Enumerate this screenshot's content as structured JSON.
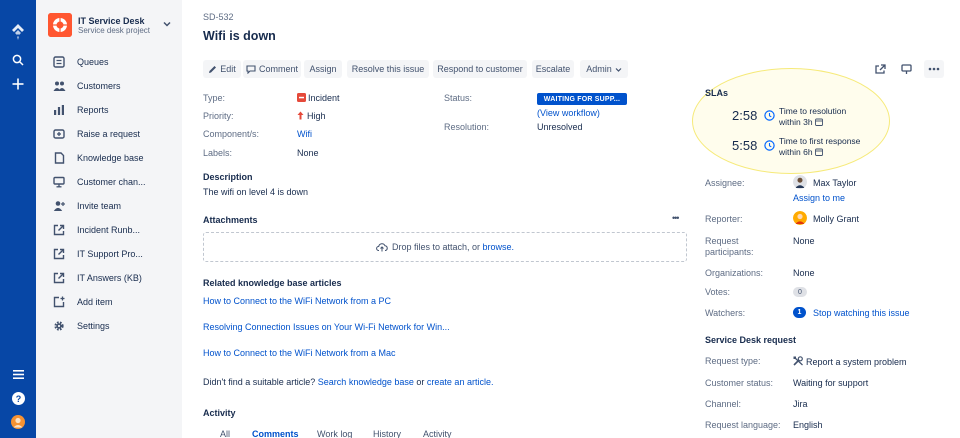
{
  "sidebar": {
    "project_name": "IT Service Desk",
    "project_type": "Service desk project",
    "items": [
      {
        "label": "Queues"
      },
      {
        "label": "Customers"
      },
      {
        "label": "Reports"
      },
      {
        "label": "Raise a request"
      },
      {
        "label": "Knowledge base"
      },
      {
        "label": "Customer chan..."
      },
      {
        "label": "Invite team"
      },
      {
        "label": "Incident Runb..."
      },
      {
        "label": "IT Support Pro..."
      },
      {
        "label": "IT Answers (KB)"
      },
      {
        "label": "Add item"
      },
      {
        "label": "Settings"
      }
    ]
  },
  "issue": {
    "key": "SD-532",
    "title": "Wifi is down"
  },
  "toolbar": {
    "edit": "Edit",
    "comment": "Comment",
    "assign": "Assign",
    "resolve": "Resolve this issue",
    "respond": "Respond to customer",
    "escalate": "Escalate",
    "admin": "Admin"
  },
  "details": {
    "type_label": "Type:",
    "type_value": "Incident",
    "priority_label": "Priority:",
    "priority_value": "High",
    "components_label": "Component/s:",
    "components_value": "Wifi",
    "labels_label": "Labels:",
    "labels_value": "None",
    "status_label": "Status:",
    "status_value": "WAITING FOR SUPP...",
    "view_workflow": "(View workflow)",
    "resolution_label": "Resolution:",
    "resolution_value": "Unresolved"
  },
  "description": {
    "heading": "Description",
    "text": "The wifi on level 4 is down"
  },
  "attachments": {
    "heading": "Attachments",
    "more": "•••",
    "drop_text": "Drop files to attach, or",
    "browse": "browse."
  },
  "kb": {
    "heading": "Related knowledge base articles",
    "articles": [
      "How to Connect to the WiFi Network from a PC",
      "Resolving Connection Issues on Your Wi-Fi Network for Win...",
      "How to Connect to the WiFi Network from a Mac"
    ],
    "not_found_prefix": "Didn't find a suitable article?",
    "search_link": "Search knowledge base",
    "or": "or",
    "create_link": "create an article."
  },
  "activity": {
    "heading": "Activity",
    "tabs": [
      "All",
      "Comments",
      "Work log",
      "History",
      "Activity"
    ],
    "active_tab": "Comments"
  },
  "sla": {
    "heading": "SLAs",
    "items": [
      {
        "time": "2:58",
        "line1": "Time to resolution",
        "line2": "within 3h"
      },
      {
        "time": "5:58",
        "line1": "Time to first response",
        "line2": "within 6h"
      }
    ]
  },
  "people": {
    "assignee_label": "Assignee:",
    "assignee": "Max Taylor",
    "assign_to_me": "Assign to me",
    "reporter_label": "Reporter:",
    "reporter": "Molly Grant",
    "participants_label_1": "Request",
    "participants_label_2": "participants:",
    "participants": "None",
    "organizations_label": "Organizations:",
    "organizations": "None",
    "votes_label": "Votes:",
    "votes": "0",
    "watchers_label": "Watchers:",
    "watchers": "1",
    "stop_watching": "Stop watching this issue"
  },
  "service_desk": {
    "heading": "Service Desk request",
    "request_type_label": "Request type:",
    "request_type": "Report a system problem",
    "customer_status_label": "Customer status:",
    "customer_status": "Waiting for support",
    "channel_label": "Channel:",
    "channel": "Jira",
    "language_label": "Request language:",
    "language": "English"
  },
  "colors": {
    "nav": "#0747a6",
    "link": "#0052cc",
    "incident": "#e5493a",
    "priority_high": "#e5493a",
    "sla_highlight": "#f6ea7a"
  }
}
